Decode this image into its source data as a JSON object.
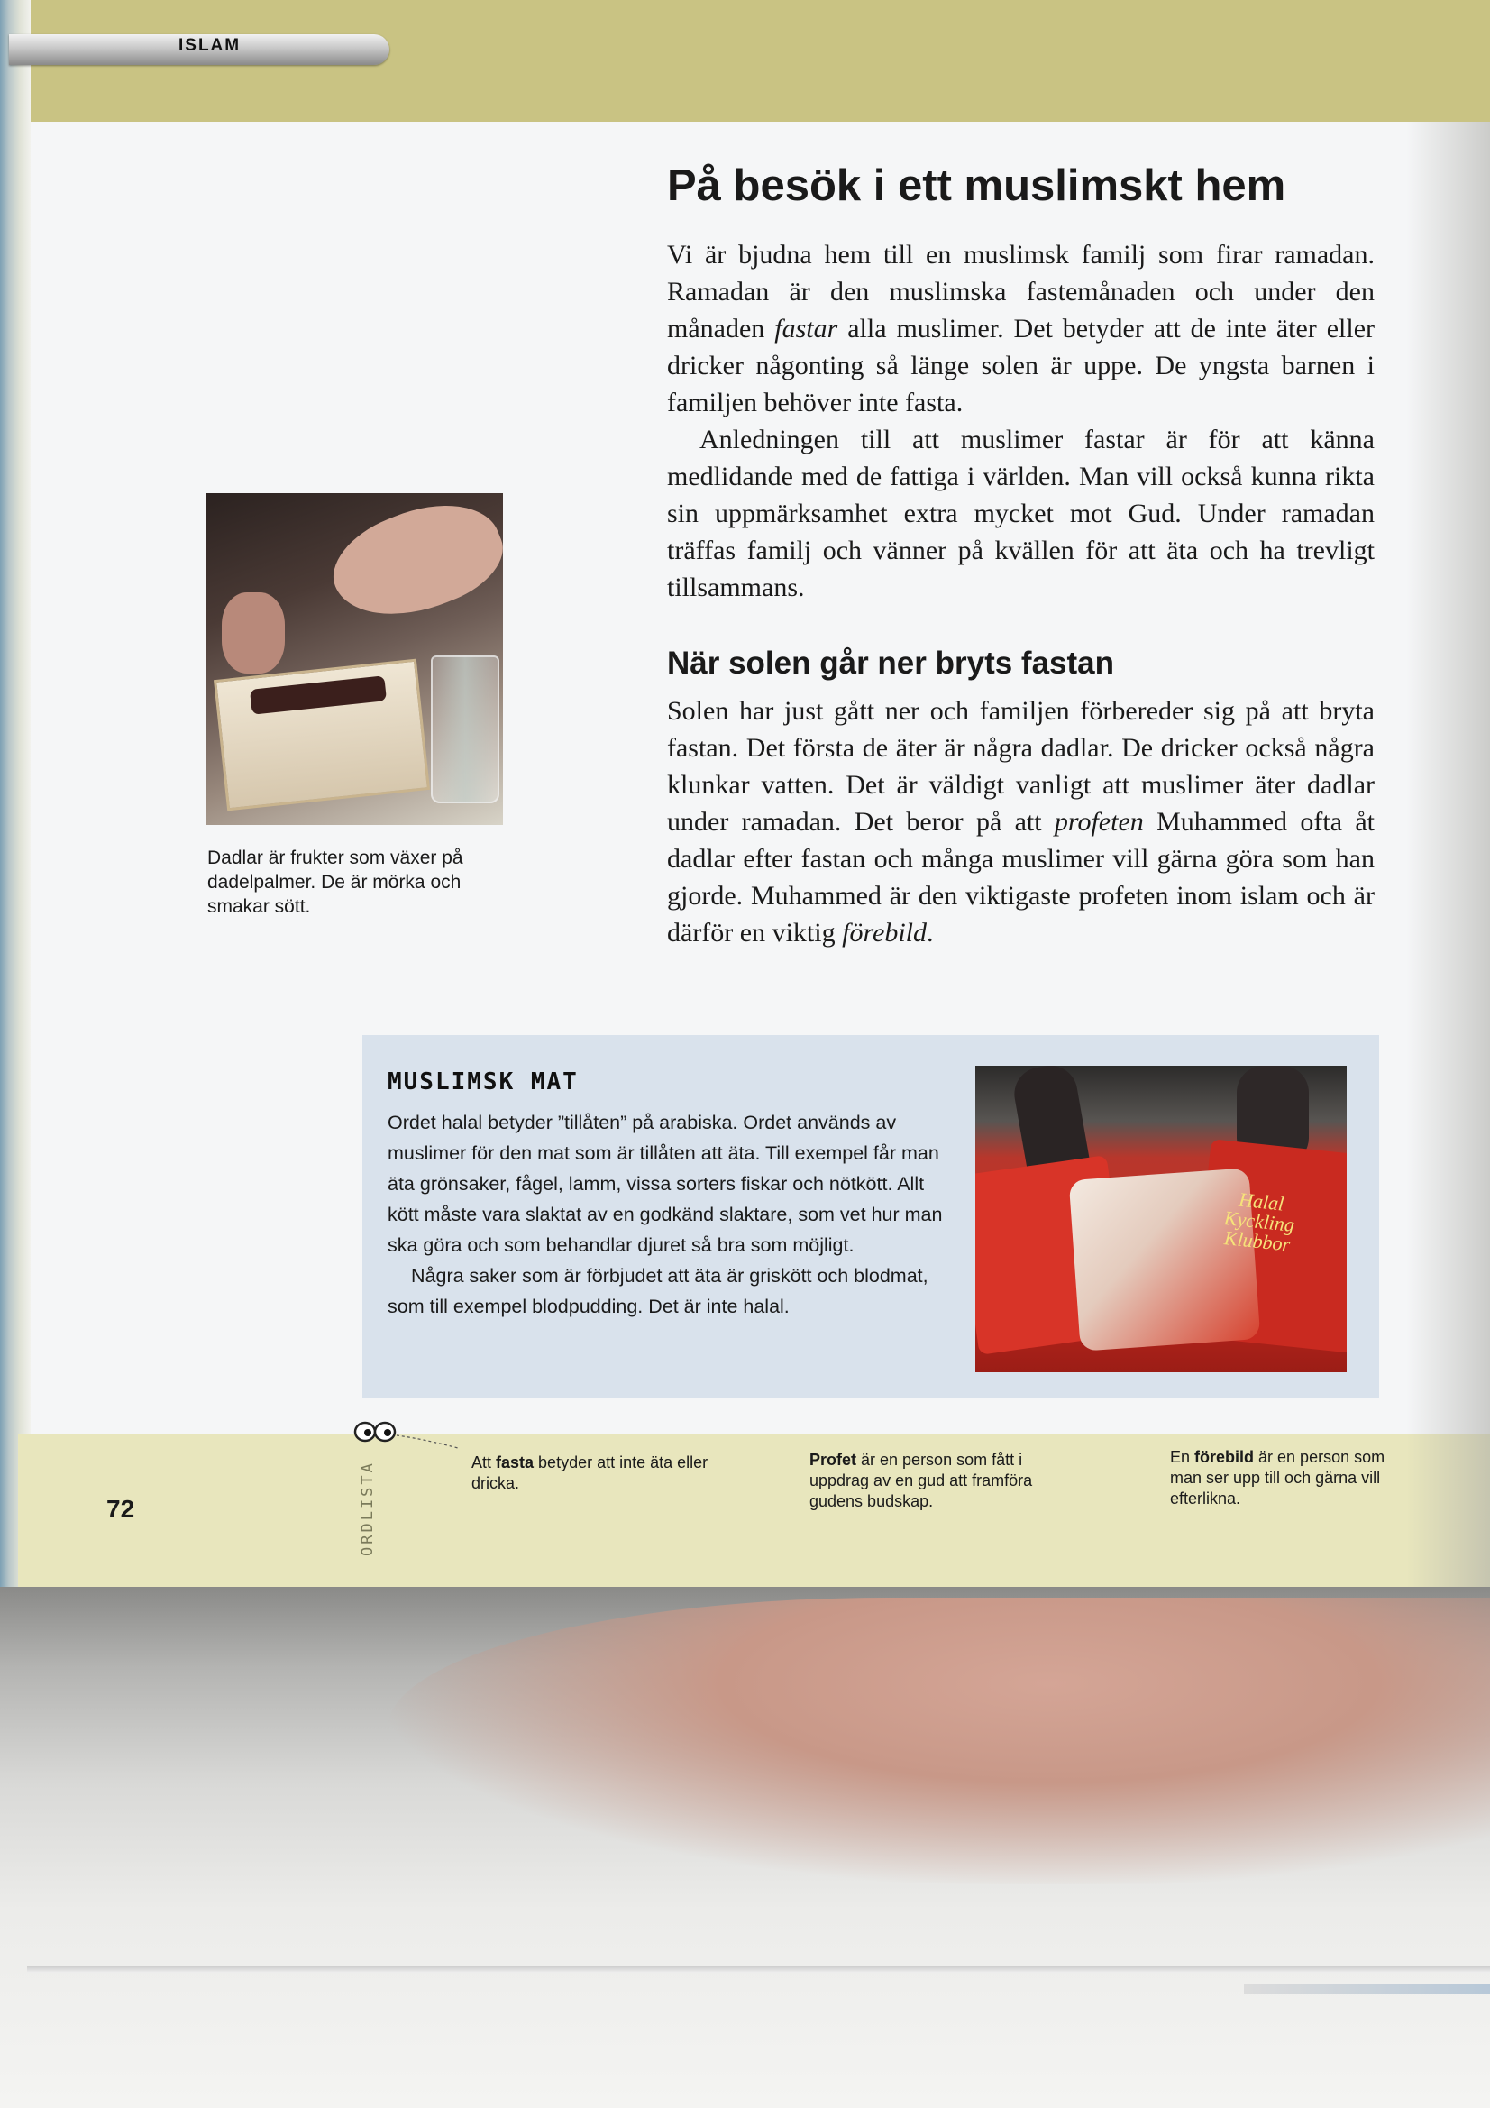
{
  "section_tab": "ISLAM",
  "article": {
    "title": "På besök i ett muslimskt hem",
    "intro_paragraphs": [
      {
        "before": "Vi är bjudna hem till en muslimsk familj som firar ramadan. Ramadan är den muslimska fastemånaden och under den månaden ",
        "term": "fastar",
        "after": " alla muslimer. Det betyder att de inte äter eller dricker någonting så länge solen är uppe. De yngsta barnen i familjen behöver inte fasta."
      },
      {
        "text": "Anledningen till att muslimer fastar är för att känna medlidande med de fattiga i världen. Man vill också kunna rikta sin uppmärksamhet extra mycket mot Gud. Under ramadan träffas familj och vänner på kvällen för att äta och ha trevligt tillsammans."
      }
    ],
    "subheading": "När solen går ner bryts fastan",
    "body2": {
      "part1": "Solen har just gått ner och familjen förbereder sig på att bryta fastan. Det första de äter är några dadlar. De dricker också några klunkar vatten. Det är väldigt vanligt att muslimer äter dadlar under ramadan. Det beror på att ",
      "term1": "profeten",
      "part2": " Muhammed ofta åt dadlar efter fastan och många muslimer vill gärna göra som han gjorde. Muhammed är den viktigaste profeten inom islam och är därför en viktig ",
      "term2": "förebild",
      "part3": "."
    }
  },
  "photo_dates": {
    "caption": "Dadlar är frukter som växer på dadelpalmer. De är mörka och smakar sött."
  },
  "info_box": {
    "title": "MUSLIMSK MAT",
    "paragraphs": [
      "Ordet halal betyder ”tillåten” på arabiska. Ordet används av muslimer för den mat som är tillåten att äta. Till exempel får man äta grönsaker, fågel, lamm, vissa sorters fiskar och nötkött. Allt kött måste vara slaktat av en godkänd slaktare, som vet hur man ska göra och som behandlar djuret så bra som möjligt.",
      "Några saker som är förbjudet att äta är griskött och blodmat, som till exempel blodpudding. Det är inte halal."
    ],
    "photo_package_text": "Halal Kyckling Klubbor"
  },
  "glossary": {
    "label": "ORDLISTA",
    "icon": "eyes-icon",
    "entries": [
      {
        "prefix": "Att ",
        "term": "fasta",
        "definition": " betyder att inte äta eller dricka."
      },
      {
        "prefix": "",
        "term": "Profet",
        "definition": " är en person som fått i uppdrag av en gud att framföra gudens budskap."
      },
      {
        "prefix": "En ",
        "term": "förebild",
        "definition": " är en person som man ser upp till och gärna vill efterlikna."
      }
    ]
  },
  "page_number": "72",
  "colors": {
    "top_band": "#c9c383",
    "bottom_band": "#e8e6bd",
    "info_box": "#d9e2ec",
    "page": "#f5f6f7"
  }
}
